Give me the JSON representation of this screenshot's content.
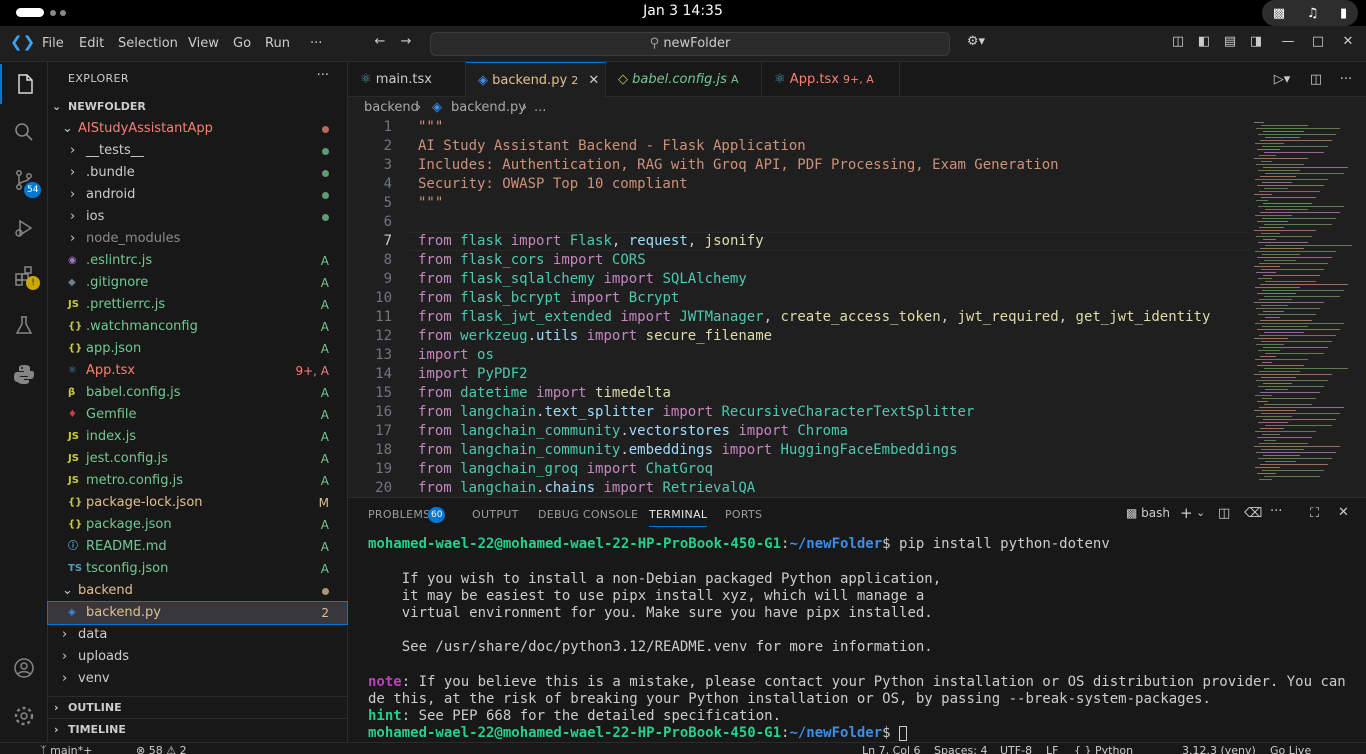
{
  "topbar": {
    "clock": "Jan 3  14:35"
  },
  "titlebar": {
    "menus": [
      "File",
      "Edit",
      "Selection",
      "View",
      "Go",
      "Run",
      "···"
    ],
    "search": "newFolder"
  },
  "activity": {
    "scm_badge": "54"
  },
  "explorer": {
    "title": "EXPLORER",
    "root": "NEWFOLDER",
    "items": [
      {
        "label": "AIStudyAssistantApp",
        "status": "",
        "color": "#f88070"
      },
      {
        "label": "__tests__",
        "status": "",
        "color": "#cccccc"
      },
      {
        "label": ".bundle",
        "status": "",
        "color": "#cccccc"
      },
      {
        "label": "android",
        "status": "",
        "color": "#cccccc"
      },
      {
        "label": "ios",
        "status": "",
        "color": "#cccccc"
      },
      {
        "label": "node_modules",
        "status": "",
        "color": "#8b8b8b"
      },
      {
        "label": ".eslintrc.js",
        "status": "A",
        "color": "#73c991"
      },
      {
        "label": ".gitignore",
        "status": "A",
        "color": "#73c991"
      },
      {
        "label": ".prettierrc.js",
        "status": "A",
        "color": "#73c991"
      },
      {
        "label": ".watchmanconfig",
        "status": "A",
        "color": "#73c991"
      },
      {
        "label": "app.json",
        "status": "A",
        "color": "#73c991"
      },
      {
        "label": "App.tsx",
        "status": "9+, A",
        "color": "#f88070"
      },
      {
        "label": "babel.config.js",
        "status": "A",
        "color": "#73c991"
      },
      {
        "label": "Gemfile",
        "status": "A",
        "color": "#73c991"
      },
      {
        "label": "index.js",
        "status": "A",
        "color": "#73c991"
      },
      {
        "label": "jest.config.js",
        "status": "A",
        "color": "#73c991"
      },
      {
        "label": "metro.config.js",
        "status": "A",
        "color": "#73c991"
      },
      {
        "label": "package-lock.json",
        "status": "M",
        "color": "#e2c08d"
      },
      {
        "label": "package.json",
        "status": "A",
        "color": "#73c991"
      },
      {
        "label": "README.md",
        "status": "A",
        "color": "#73c991"
      },
      {
        "label": "tsconfig.json",
        "status": "A",
        "color": "#73c991"
      },
      {
        "label": "backend",
        "status": "",
        "color": "#e2c08d"
      },
      {
        "label": "backend.py",
        "status": "2",
        "color": "#e2c08d"
      },
      {
        "label": "data",
        "status": "",
        "color": "#cccccc"
      },
      {
        "label": "uploads",
        "status": "",
        "color": "#cccccc"
      },
      {
        "label": "venv",
        "status": "",
        "color": "#cccccc"
      }
    ],
    "outline": "OUTLINE",
    "timeline": "TIMELINE"
  },
  "tabs": [
    {
      "name": "main.tsx",
      "suffix": "",
      "color": "#cccccc"
    },
    {
      "name": "backend.py",
      "suffix": "2",
      "color": "#e2c08d"
    },
    {
      "name": "babel.config.js",
      "suffix": "A",
      "color": "#73c991"
    },
    {
      "name": "App.tsx",
      "suffix": "9+, A",
      "color": "#f88070"
    }
  ],
  "breadcrumb": [
    "backend",
    "backend.py",
    "..."
  ],
  "code": [
    "\"\"\"",
    "AI Study Assistant Backend - Flask Application",
    "Includes: Authentication, RAG with Groq API, PDF Processing, Exam Generation",
    "Security: OWASP Top 10 compliant",
    "\"\"\"",
    "",
    "from flask import Flask, request, jsonify",
    "from flask_cors import CORS",
    "from flask_sqlalchemy import SQLAlchemy",
    "from flask_bcrypt import Bcrypt",
    "from flask_jwt_extended import JWTManager, create_access_token, jwt_required, get_jwt_identity",
    "from werkzeug.utils import secure_filename",
    "import os",
    "import PyPDF2",
    "from datetime import timedelta",
    "from langchain.text_splitter import RecursiveCharacterTextSplitter",
    "from langchain_community.vectorstores import Chroma",
    "from langchain_community.embeddings import HuggingFaceEmbeddings",
    "from langchain_groq import ChatGroq",
    "from langchain.chains import RetrievalQA"
  ],
  "panel": {
    "tabs": [
      "PROBLEMS",
      "OUTPUT",
      "DEBUG CONSOLE",
      "TERMINAL",
      "PORTS"
    ],
    "problems_count": "60",
    "shell": "bash",
    "prompt_user": "mohamed-wael-22@mohamed-wael-22-HP-ProBook-450-G1",
    "prompt_path": "~/newFolder",
    "command": "$ pip install python-dotenv",
    "lines": [
      "    If you wish to install a non-Debian packaged Python application,",
      "    it may be easiest to use pipx install xyz, which will manage a",
      "    virtual environment for you. Make sure you have pipx installed.",
      "",
      "    See /usr/share/doc/python3.12/README.venv for more information."
    ],
    "note_label": "note",
    "note_text": ": If you believe this is a mistake, please contact your Python installation or OS distribution provider. You can overri",
    "note_text2": "de this, at the risk of breaking your Python installation or OS, by passing --break-system-packages.",
    "hint_label": "hint",
    "hint_text": ": See PEP 668 for the detailed specification.",
    "prompt2_tail": "$ "
  },
  "status": {
    "branch": "main*+",
    "problems": "⊗ 58 ⚠ 2",
    "position": "Ln 7, Col 6",
    "spaces": "Spaces: 4",
    "encoding": "UTF-8",
    "eol": "LF",
    "language": "{ } Python",
    "interpreter": "3.12.3 (venv)",
    "golive": "Go Live"
  }
}
